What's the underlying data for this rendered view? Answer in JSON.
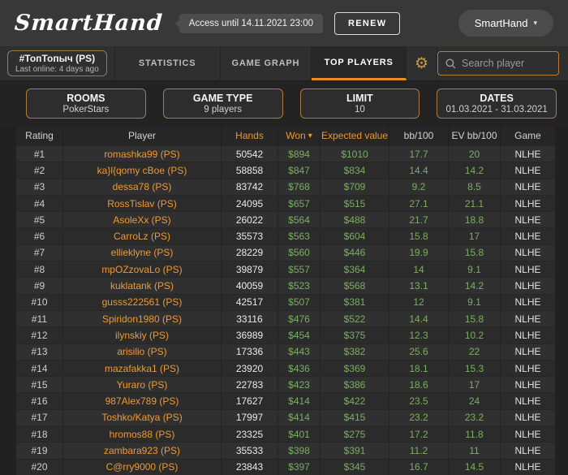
{
  "header": {
    "logo": "SmartHand",
    "access_badge": "Access until 14.11.2021 23:00",
    "renew_label": "RENEW",
    "account_label": "SmartHand"
  },
  "nav": {
    "player": {
      "name": "#ТопТопыч (PS)",
      "last_online": "Last online: 4 days ago"
    },
    "tabs": [
      {
        "label": "STATISTICS",
        "active": false
      },
      {
        "label": "GAME GRAPH",
        "active": false
      },
      {
        "label": "TOP PLAYERS",
        "active": true
      }
    ],
    "search_placeholder": "Search player"
  },
  "filters": [
    {
      "label": "ROOMS",
      "value": "PokerStars"
    },
    {
      "label": "GAME TYPE",
      "value": "9 players"
    },
    {
      "label": "LIMIT",
      "value": "10"
    },
    {
      "label": "DATES",
      "value": "01.03.2021 - 31.03.2021"
    }
  ],
  "table": {
    "columns": [
      {
        "label": "Rating"
      },
      {
        "label": "Player"
      },
      {
        "label": "Hands"
      },
      {
        "label": "Won",
        "sorted": "desc"
      },
      {
        "label": "Expected value"
      },
      {
        "label": "bb/100"
      },
      {
        "label": "EV bb/100"
      },
      {
        "label": "Game"
      }
    ],
    "rows": [
      {
        "rating": "#1",
        "player": "romashka99 (PS)",
        "hands": "50542",
        "won": "$894",
        "expected": "$1010",
        "bb100": "17.7",
        "ev_bb100": "20",
        "game": "NLHE"
      },
      {
        "rating": "#2",
        "player": "ka}l{qomy cBoe (PS)",
        "hands": "58858",
        "won": "$847",
        "expected": "$834",
        "bb100": "14.4",
        "ev_bb100": "14.2",
        "game": "NLHE"
      },
      {
        "rating": "#3",
        "player": "dessa78 (PS)",
        "hands": "83742",
        "won": "$768",
        "expected": "$709",
        "bb100": "9.2",
        "ev_bb100": "8.5",
        "game": "NLHE"
      },
      {
        "rating": "#4",
        "player": "RossTislav (PS)",
        "hands": "24095",
        "won": "$657",
        "expected": "$515",
        "bb100": "27.1",
        "ev_bb100": "21.1",
        "game": "NLHE"
      },
      {
        "rating": "#5",
        "player": "AsoleXx (PS)",
        "hands": "26022",
        "won": "$564",
        "expected": "$488",
        "bb100": "21.7",
        "ev_bb100": "18.8",
        "game": "NLHE"
      },
      {
        "rating": "#6",
        "player": "CarroLz (PS)",
        "hands": "35573",
        "won": "$563",
        "expected": "$604",
        "bb100": "15.8",
        "ev_bb100": "17",
        "game": "NLHE"
      },
      {
        "rating": "#7",
        "player": "ellieklyne (PS)",
        "hands": "28229",
        "won": "$560",
        "expected": "$446",
        "bb100": "19.9",
        "ev_bb100": "15.8",
        "game": "NLHE"
      },
      {
        "rating": "#8",
        "player": "mpOZzovaLo (PS)",
        "hands": "39879",
        "won": "$557",
        "expected": "$364",
        "bb100": "14",
        "ev_bb100": "9.1",
        "game": "NLHE"
      },
      {
        "rating": "#9",
        "player": "kuklatank (PS)",
        "hands": "40059",
        "won": "$523",
        "expected": "$568",
        "bb100": "13.1",
        "ev_bb100": "14.2",
        "game": "NLHE"
      },
      {
        "rating": "#10",
        "player": "gusss222561 (PS)",
        "hands": "42517",
        "won": "$507",
        "expected": "$381",
        "bb100": "12",
        "ev_bb100": "9.1",
        "game": "NLHE"
      },
      {
        "rating": "#11",
        "player": "Spiridon1980 (PS)",
        "hands": "33116",
        "won": "$476",
        "expected": "$522",
        "bb100": "14.4",
        "ev_bb100": "15.8",
        "game": "NLHE"
      },
      {
        "rating": "#12",
        "player": "ilynskiy (PS)",
        "hands": "36989",
        "won": "$454",
        "expected": "$375",
        "bb100": "12.3",
        "ev_bb100": "10.2",
        "game": "NLHE"
      },
      {
        "rating": "#13",
        "player": "arisilio (PS)",
        "hands": "17336",
        "won": "$443",
        "expected": "$382",
        "bb100": "25.6",
        "ev_bb100": "22",
        "game": "NLHE"
      },
      {
        "rating": "#14",
        "player": "mazafakka1 (PS)",
        "hands": "23920",
        "won": "$436",
        "expected": "$369",
        "bb100": "18.1",
        "ev_bb100": "15.3",
        "game": "NLHE"
      },
      {
        "rating": "#15",
        "player": "Yuraro (PS)",
        "hands": "22783",
        "won": "$423",
        "expected": "$386",
        "bb100": "18.6",
        "ev_bb100": "17",
        "game": "NLHE"
      },
      {
        "rating": "#16",
        "player": "987Alex789 (PS)",
        "hands": "17627",
        "won": "$414",
        "expected": "$422",
        "bb100": "23.5",
        "ev_bb100": "24",
        "game": "NLHE"
      },
      {
        "rating": "#17",
        "player": "Toshko/Katya (PS)",
        "hands": "17997",
        "won": "$414",
        "expected": "$415",
        "bb100": "23.2",
        "ev_bb100": "23.2",
        "game": "NLHE"
      },
      {
        "rating": "#18",
        "player": "hromos88 (PS)",
        "hands": "23325",
        "won": "$401",
        "expected": "$275",
        "bb100": "17.2",
        "ev_bb100": "11.8",
        "game": "NLHE"
      },
      {
        "rating": "#19",
        "player": "zambara923 (PS)",
        "hands": "35533",
        "won": "$398",
        "expected": "$391",
        "bb100": "11.2",
        "ev_bb100": "11",
        "game": "NLHE"
      },
      {
        "rating": "#20",
        "player": "C@rry9000 (PS)",
        "hands": "23843",
        "won": "$397",
        "expected": "$345",
        "bb100": "16.7",
        "ev_bb100": "14.5",
        "game": "NLHE"
      }
    ]
  },
  "icons": {
    "gear": "⚙",
    "sort_desc": "▾",
    "caret_down": "▾"
  },
  "colors": {
    "accent_orange": "#ef962f",
    "value_green": "#7cad63",
    "tab_underline": "#f08c1e",
    "filter_border": "#a87c3e"
  }
}
